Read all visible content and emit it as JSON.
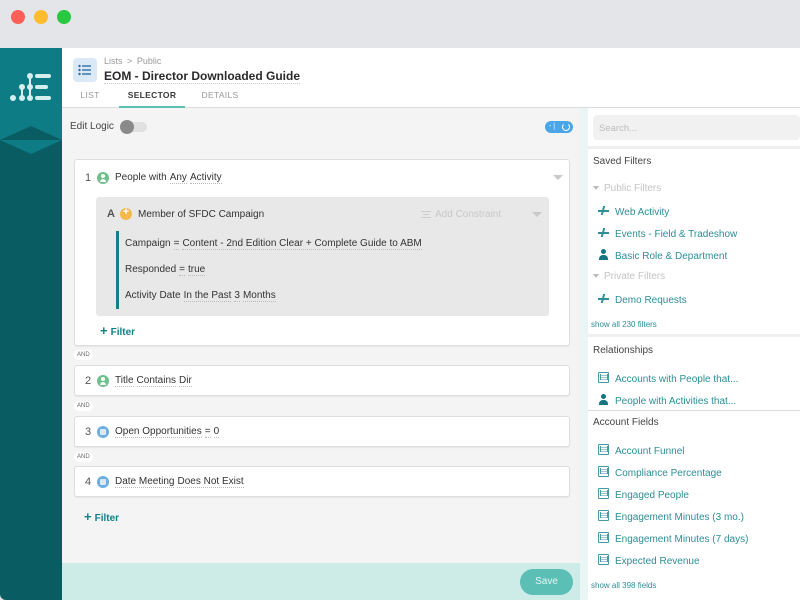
{
  "window": {
    "controls": [
      "close",
      "minimize",
      "maximize"
    ]
  },
  "sidebar": {
    "logo": "app-logo"
  },
  "header": {
    "breadcrumb": [
      "Lists",
      ">",
      "Public"
    ],
    "title": "EOM - Director Downloaded Guide",
    "tabs": [
      {
        "label": "LIST",
        "active": false
      },
      {
        "label": "SELECTOR",
        "active": true
      },
      {
        "label": "DETAILS",
        "active": false
      }
    ]
  },
  "toolbar": {
    "edit_logic_label": "Edit Logic",
    "edit_logic_on": false,
    "count_badge": "- |"
  },
  "filters": [
    {
      "number": "1",
      "icon": "person-icon",
      "parts": [
        "People with",
        "Any",
        "Activity"
      ],
      "sub": {
        "letter": "A",
        "title": "Member of SFDC Campaign",
        "add_constraint": "Add Constraint",
        "constraints": [
          [
            "Campaign",
            "=",
            "Content - 2nd Edition Clear + Complete Guide to ABM"
          ],
          [
            "Responded",
            "=",
            "true"
          ],
          [
            "Activity Date",
            "In the Past",
            "3",
            "Months"
          ]
        ]
      },
      "add_filter": "Filter"
    },
    {
      "number": "2",
      "icon": "person-icon",
      "parts": [
        "Title",
        "Contains",
        "Dir"
      ]
    },
    {
      "number": "3",
      "icon": "account-icon",
      "parts": [
        "Open Opportunities",
        "=",
        "0"
      ]
    },
    {
      "number": "4",
      "icon": "account-icon",
      "parts": [
        "Date Meeting",
        "Does Not Exist"
      ]
    }
  ],
  "and_label": "AND",
  "add_filter_label": "Filter",
  "footer": {
    "save_label": "Save"
  },
  "right_panel": {
    "search_placeholder": "Search...",
    "saved_filters": {
      "heading": "Saved Filters",
      "public_group": "Public Filters",
      "public_items": [
        {
          "label": "Web Activity",
          "icon": "activity"
        },
        {
          "label": "Events - Field & Tradeshow",
          "icon": "activity"
        },
        {
          "label": "Basic Role & Department",
          "icon": "person"
        }
      ],
      "private_group": "Private Filters",
      "private_items": [
        {
          "label": "Demo Requests",
          "icon": "activity"
        }
      ],
      "show_all": "show all 230 filters"
    },
    "relationships": {
      "heading": "Relationships",
      "items": [
        {
          "label": "Accounts with People that...",
          "icon": "building"
        },
        {
          "label": "People with Activities that...",
          "icon": "person"
        }
      ]
    },
    "account_fields": {
      "heading": "Account Fields",
      "items": [
        {
          "label": "Account Funnel"
        },
        {
          "label": "Compliance Percentage"
        },
        {
          "label": "Engaged People"
        },
        {
          "label": "Engagement Minutes (3 mo.)"
        },
        {
          "label": "Engagement Minutes (7 days)"
        },
        {
          "label": "Expected Revenue"
        }
      ],
      "show_all": "show all 398 fields"
    }
  },
  "colors": {
    "sidebar": "#0a5c63",
    "accent": "#157e86",
    "link": "#2d8e96",
    "save_button": "#5cbfb5",
    "badge": "#4aa6e8"
  }
}
